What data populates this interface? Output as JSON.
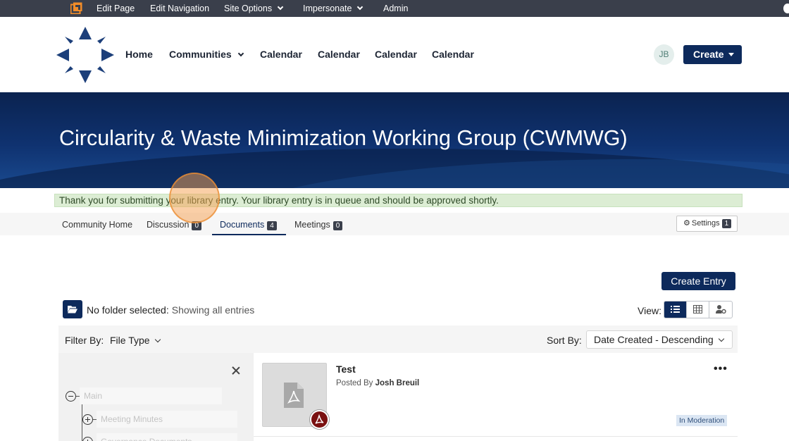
{
  "admin_bar": {
    "logo_icon": "site-builder-icon",
    "items": [
      {
        "label": "Edit Page"
      },
      {
        "label": "Edit Navigation"
      },
      {
        "label": "Site Options"
      },
      {
        "label": "Impersonate"
      },
      {
        "label": "Admin"
      }
    ]
  },
  "nav": {
    "logo_icon": "compass-logo-icon",
    "items": [
      {
        "label": "Home"
      },
      {
        "label": "Communities"
      },
      {
        "label": "Calendar"
      },
      {
        "label": "Calendar"
      },
      {
        "label": "Calendar"
      },
      {
        "label": "Calendar"
      }
    ],
    "avatar_initials": "JB",
    "create_label": "Create"
  },
  "banner": {
    "title": "Circularity & Waste Minimization Working Group (CWMWG)"
  },
  "alert": {
    "message": "Thank you for submitting your library entry. Your library entry is in queue and should be approved shortly."
  },
  "tabs": [
    {
      "label": "Community Home",
      "count": ""
    },
    {
      "label": "Discussion",
      "count": "0"
    },
    {
      "label": "Documents",
      "count": "4",
      "active": true
    },
    {
      "label": "Meetings",
      "count": "0"
    }
  ],
  "settings": {
    "label": "Settings",
    "count": "1",
    "icon": "gear-icon"
  },
  "library": {
    "create_entry_label": "Create Entry",
    "folder_status_label": "No folder selected:",
    "folder_status_value": "Showing all entries",
    "view_label": "View:",
    "view_modes": [
      "list-view-icon",
      "grid-view-icon",
      "user-settings-icon"
    ],
    "filter_label": "Filter By:",
    "filter_value": "File Type",
    "sort_label": "Sort By:",
    "sort_value": "Date Created - Descending"
  },
  "folder_tree": {
    "nodes": [
      {
        "label": "Main"
      },
      {
        "label": "Meeting Minutes"
      },
      {
        "label": "Governance Documents"
      }
    ]
  },
  "entries": [
    {
      "title": "Test",
      "posted_by_prefix": "Posted By",
      "author": "Josh Breuil",
      "file_type_icon": "pdf-icon",
      "status": "In Moderation"
    }
  ],
  "colors": {
    "primary": "#0d2a5c",
    "admin_bar": "#3a3f4b",
    "alert_bg": "#dcedd4",
    "click_indicator": "#f5a050"
  }
}
